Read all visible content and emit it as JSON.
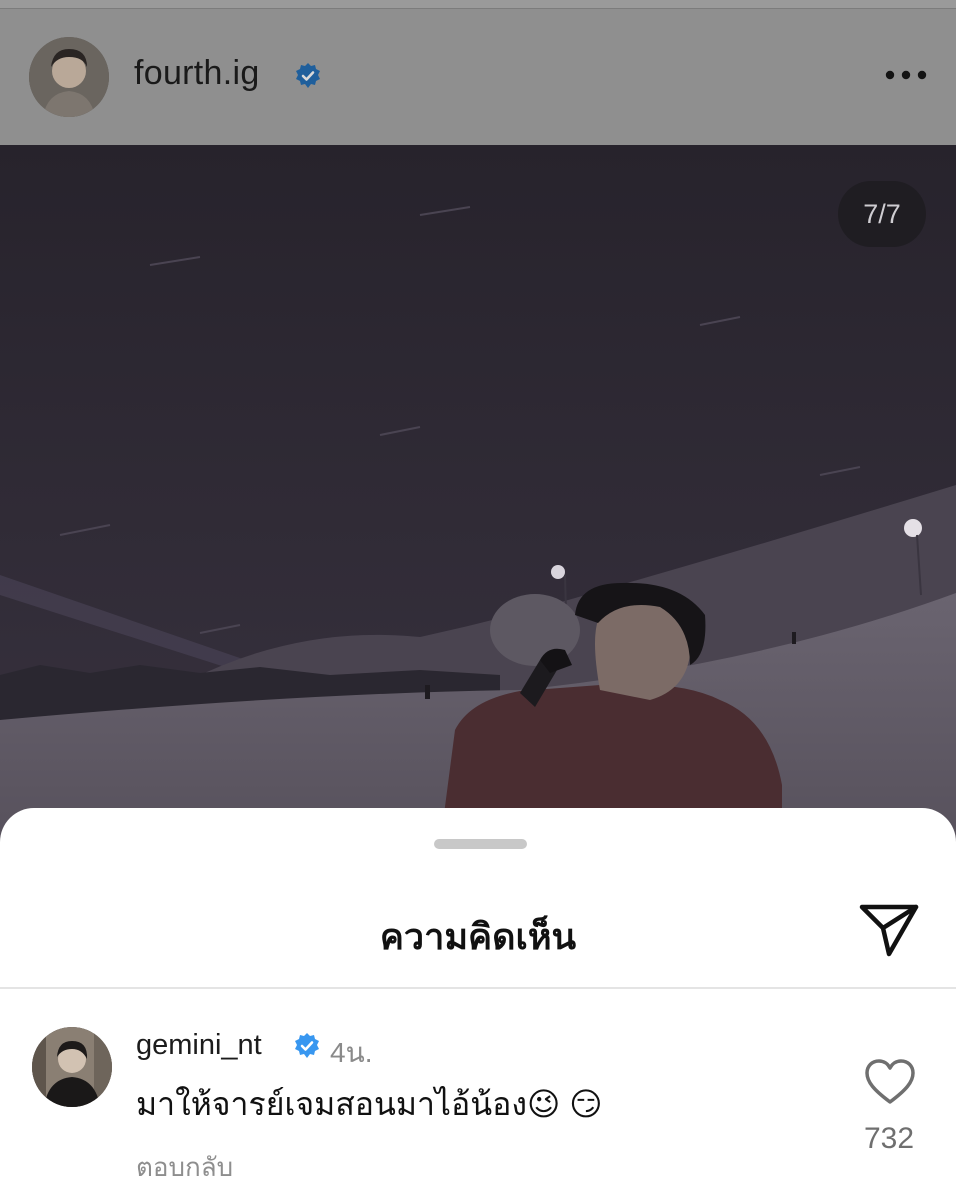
{
  "post": {
    "author": {
      "username": "fourth.ig",
      "verified": true
    },
    "image_counter": "7/7"
  },
  "comments_sheet": {
    "title": "ความคิดเห็น",
    "share_icon": "send-icon",
    "comments": [
      {
        "username": "gemini_nt",
        "verified": true,
        "time": "4น.",
        "text": "มาให้จารย์เจมสอนมาไอ้น้อง😉 😏",
        "reply_label": "ตอบกลับ",
        "likes": "732"
      }
    ]
  },
  "colors": {
    "verified_blue": "#3897f0",
    "dim_overlay": "#8f8f8f",
    "sheet_background": "#ffffff"
  }
}
